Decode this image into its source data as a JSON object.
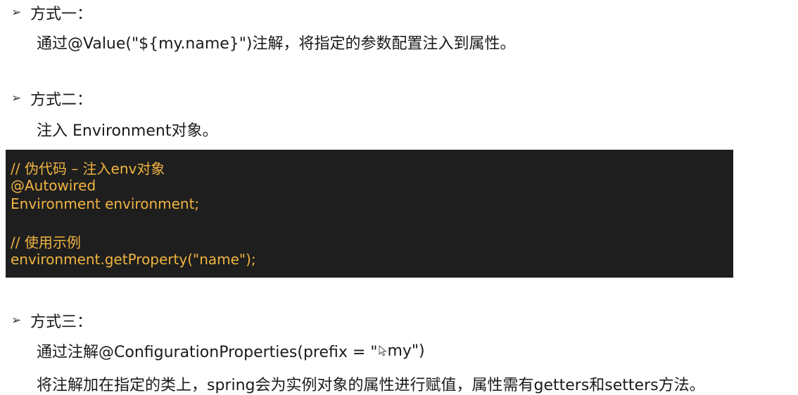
{
  "sections": [
    {
      "bullet": "➢",
      "heading": "方式一：",
      "lines": [
        "通过@Value(\"${my.name}\")注解，将指定的参数配置注入到属性。"
      ]
    },
    {
      "bullet": "➢",
      "heading": "方式二：",
      "lines": [
        "注入 Environment对象。"
      ]
    },
    {
      "bullet": "➢",
      "heading": "方式三：",
      "lines": [
        "通过注解@ConfigurationProperties(prefix = \"",
        "my\")",
        "将注解加在指定的类上，spring会为实例对象的属性进行赋值，属性需有getters和setters方法。"
      ]
    }
  ],
  "code": {
    "lines": [
      "// 伪代码 – 注入env对象",
      "@Autowired",
      "Environment environment;",
      "",
      "// 使用示例",
      "environment.getProperty(\"name\");"
    ]
  },
  "colors": {
    "code_background": "#1e1e1e",
    "code_text": "#f0b441"
  }
}
